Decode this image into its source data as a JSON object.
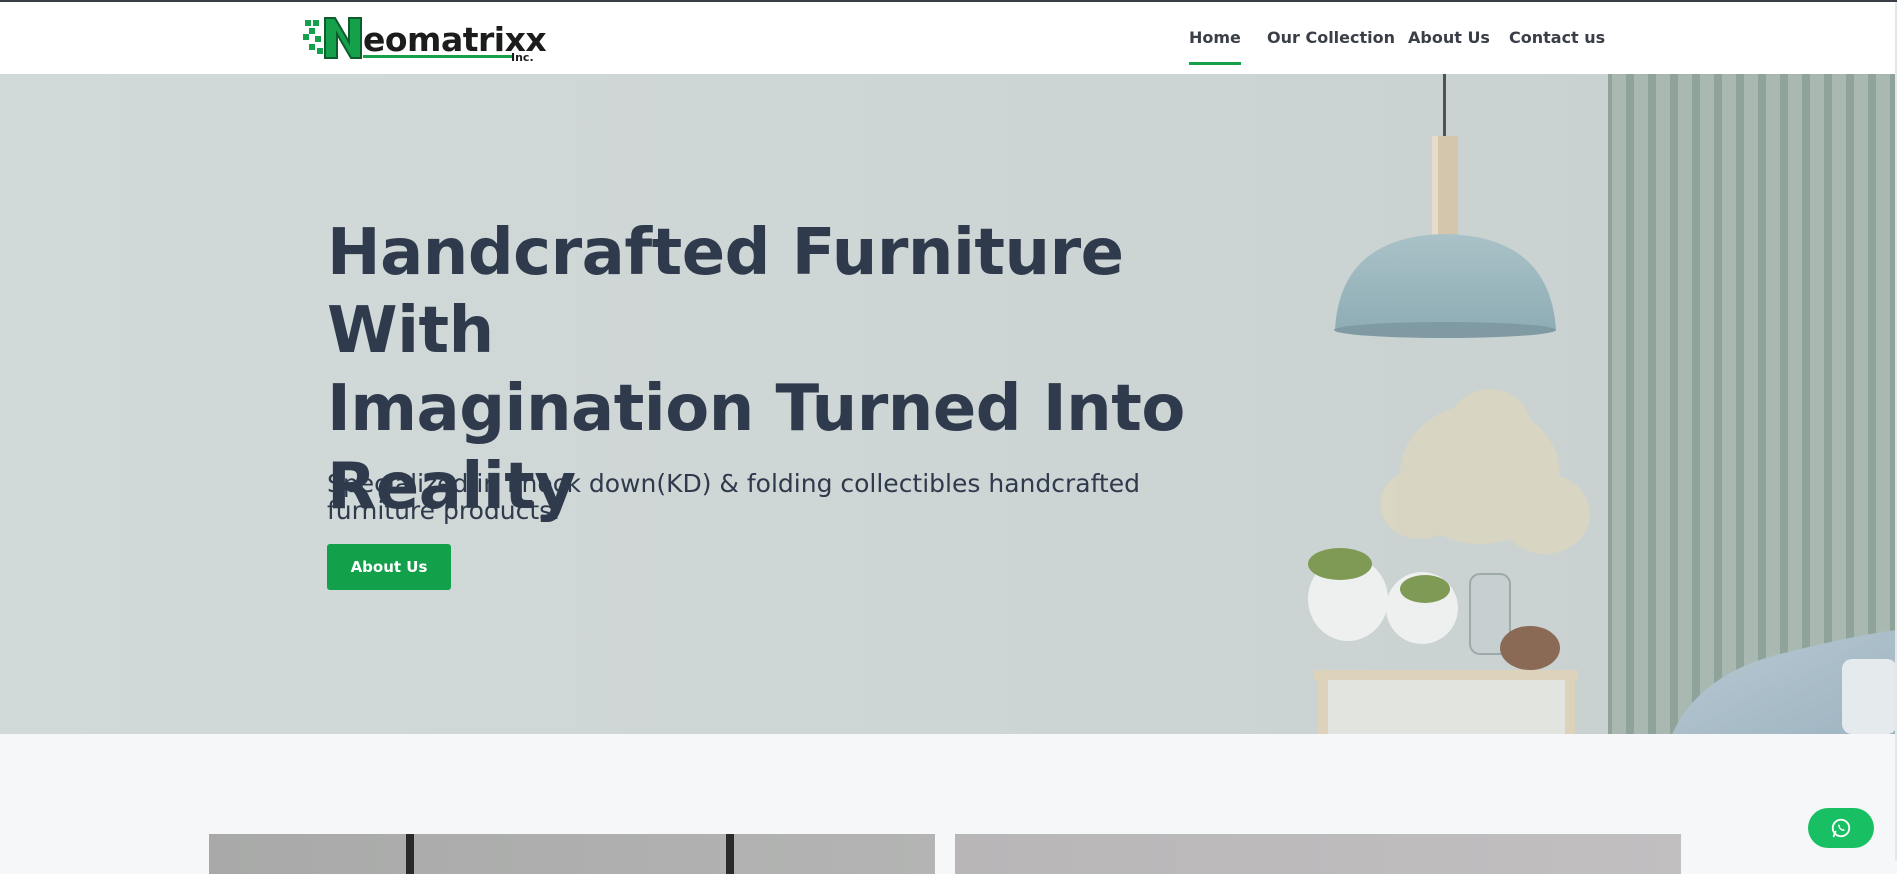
{
  "brand": {
    "name": "eomatrixx",
    "suffix": "Inc.",
    "accent_color": "#15a04b"
  },
  "nav": {
    "items": [
      {
        "label": "Home",
        "active": true
      },
      {
        "label": "Our Collection",
        "active": false
      },
      {
        "label": "About Us",
        "active": false
      },
      {
        "label": "Contact us",
        "active": false
      }
    ]
  },
  "hero": {
    "title_lines": [
      "Handcrafted Furniture With",
      "Imagination Turned Into",
      "Reality"
    ],
    "subtitle": "Specialized in knock down(KD) & folding collectibles handcrafted furniture products.",
    "cta_label": "About Us",
    "cta_color": "#12a04b"
  },
  "whatsapp": {
    "icon": "whatsapp-icon",
    "color": "#19c063"
  }
}
